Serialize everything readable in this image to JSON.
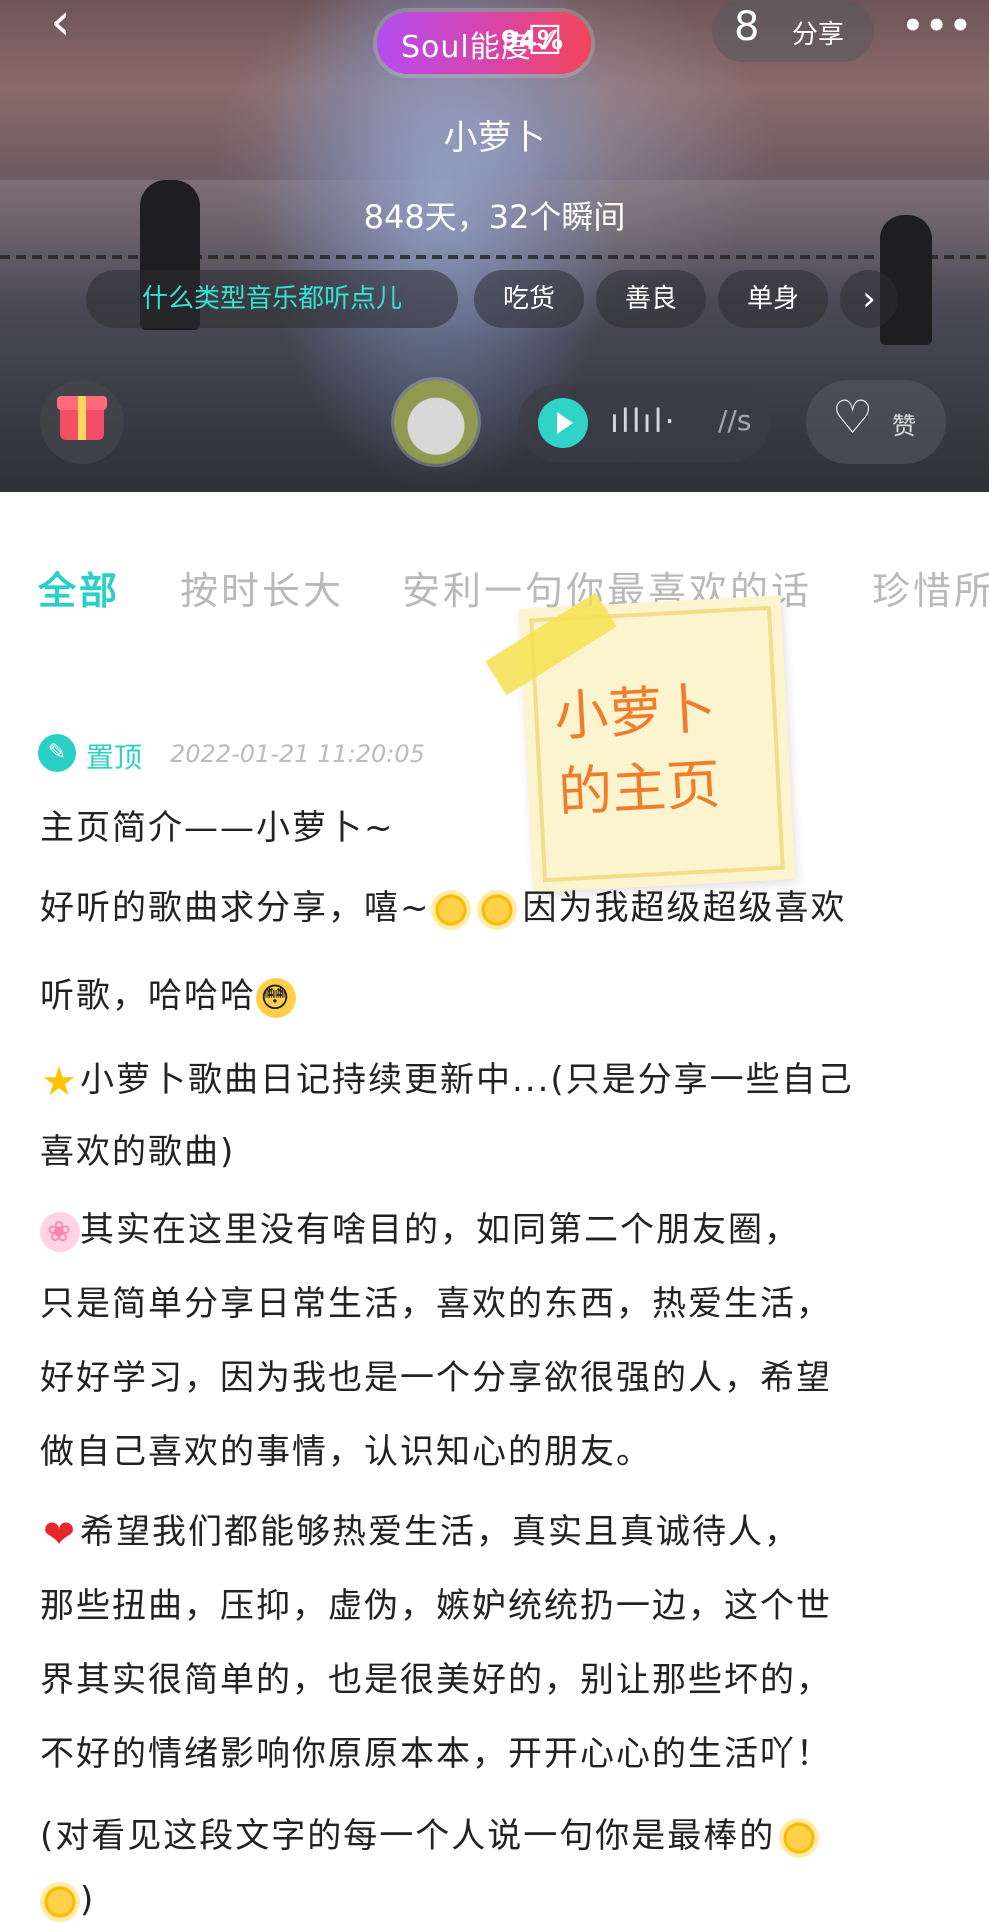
{
  "header": {
    "back_icon": "‹",
    "soul_label": "Soul能度",
    "soul_percent": "94%",
    "share_label": "分享",
    "more_icon": "•••",
    "username": "小萝卜",
    "stats": "848天，32个瞬间",
    "tags": [
      "什么类型音乐都听点儿",
      "吃货",
      "善良",
      "单身"
    ],
    "tags_more_icon": "›",
    "voice_duration": "//s",
    "like_label": "赞"
  },
  "tabs": [
    "全部",
    "按时长大",
    "安利一句你最喜欢的话",
    "珍惜所"
  ],
  "sticky_note": [
    "小萝卜",
    "的主页"
  ],
  "post": {
    "pin_label": "置顶",
    "timestamp": "2022-01-21 11:20:05",
    "lines": [
      "主页简介——小萝卜~",
      "好听的歌曲求分享，嘻~",
      "因为我超级超级喜欢",
      "听歌，哈哈哈",
      "小萝卜歌曲日记持续更新中...(只是分享一些自己",
      "喜欢的歌曲)",
      "其实在这里没有啥目的，如同第二个朋友圈，",
      "只是简单分享日常生活，喜欢的东西，热爱生活，",
      "好好学习，因为我也是一个分享欲很强的人，希望",
      "做自己喜欢的事情，认识知心的朋友。",
      "希望我们都能够热爱生活，真实且真诚待人，",
      "那些扭曲，压抑，虚伪，嫉妒统统扔一边，这个世",
      "界其实很简单的，也是很美好的，别让那些坏的，",
      "不好的情绪影响你原原本本，开开心心的生活吖！",
      "(对看见这段文字的每一个人说一句你是最棒的",
      ")"
    ]
  },
  "colors": {
    "accent": "#2ad0c6",
    "sticky_text": "#f07c2c",
    "soul_gradient_start": "#b44cf0",
    "soul_gradient_end": "#f24557"
  },
  "icons": [
    "back-icon",
    "check-icon",
    "add-friend-icon",
    "more-icon",
    "gift-icon",
    "play-icon",
    "heart-icon",
    "pin-icon",
    "sun-emoji",
    "flushed-emoji",
    "star-emoji",
    "paw-emoji",
    "heart-emoji"
  ]
}
